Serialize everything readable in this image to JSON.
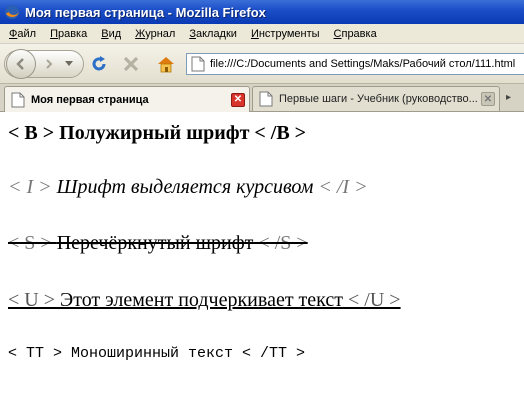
{
  "window": {
    "title": "Моя первая страница - Mozilla Firefox"
  },
  "menu": [
    {
      "first": "Ф",
      "rest": "айл"
    },
    {
      "first": "П",
      "rest": "равка"
    },
    {
      "first": "В",
      "rest": "ид"
    },
    {
      "first": "Ж",
      "rest": "урнал"
    },
    {
      "first": "З",
      "rest": "акладки"
    },
    {
      "first": "И",
      "rest": "нструменты"
    },
    {
      "first": "С",
      "rest": "правка"
    }
  ],
  "nav": {
    "url": "file:///C:/Documents and Settings/Maks/Рабочий стол/111.html"
  },
  "tabs": [
    {
      "label": "Моя первая страница",
      "active": true
    },
    {
      "label": "Первые шаги - Учебник (руководство...",
      "active": false
    }
  ],
  "content": {
    "bold": "< B > Полужирный шрифт < /B >",
    "italic_open": "< I > ",
    "italic_text": "Шрифт выделяется курсивом",
    "italic_close": " < /I >",
    "strike_open": "< S > ",
    "strike_text": "Перечёркнутый шрифт",
    "strike_close": " < /S >",
    "under_open": "< U > ",
    "under_text": "Этот элемент подчеркивает текст",
    "under_close": " < /U >",
    "mono": "< TT > Моноширинный текст < /TT >"
  },
  "colors": {
    "titlebar": "#0a3ab4",
    "chrome": "#ece9d8",
    "tab_close_active": "#d8342b"
  }
}
